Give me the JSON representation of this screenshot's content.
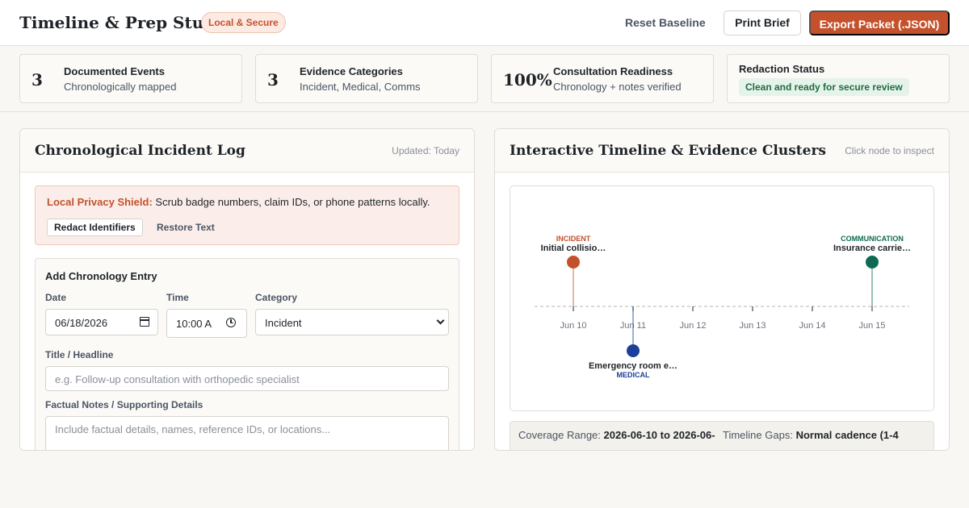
{
  "header": {
    "title": "Timeline & Prep Studio",
    "badge": "Local & Secure",
    "reset_label": "Reset Baseline",
    "print_label": "Print Brief",
    "export_label": "Export Packet (.JSON)"
  },
  "stats": [
    {
      "value": "3",
      "title": "Documented Events",
      "sub": "Chronologically mapped"
    },
    {
      "value": "3",
      "title": "Evidence Categories",
      "sub": "Incident, Medical, Comms"
    },
    {
      "value": "100%",
      "title": "Consultation Readiness",
      "sub": "Chronology + notes verified"
    }
  ],
  "redaction": {
    "title": "Redaction Status",
    "status": "Clean and ready for secure review"
  },
  "log_panel": {
    "title": "Chronological Incident Log",
    "meta": "Updated: Today",
    "shield_label": "Local Privacy Shield:",
    "shield_text": " Scrub badge numbers, claim IDs, or phone patterns locally.",
    "redact_label": "Redact Identifiers",
    "restore_label": "Restore Text",
    "form": {
      "title": "Add Chronology Entry",
      "date_label": "Date",
      "date_value": "06/18/2026",
      "time_label": "Time",
      "time_value": "10:00 A",
      "category_label": "Category",
      "category_value": "Incident",
      "headline_label": "Title / Headline",
      "headline_placeholder": "e.g. Follow-up consultation with orthopedic specialist",
      "notes_label": "Factual Notes / Supporting Details",
      "notes_placeholder": "Include factual details, names, reference IDs, or locations..."
    }
  },
  "timeline_panel": {
    "title": "Interactive Timeline & Evidence Clusters",
    "meta": "Click node to inspect",
    "coverage_label": "Coverage Range:",
    "coverage_value": "2026-06-10 to 2026-06-",
    "gaps_label": "Timeline Gaps:",
    "gaps_value": "Normal cadence (1-4"
  },
  "colors": {
    "incident": "#c4512c",
    "medical": "#1d3f9a",
    "communication": "#0e6b53"
  },
  "timeline": {
    "ticks": [
      "Jun 10",
      "Jun 11",
      "Jun 12",
      "Jun 13",
      "Jun 14",
      "Jun 15"
    ],
    "events": [
      {
        "day_index": 0,
        "category": "INCIDENT",
        "title": "Initial collisio…",
        "side": "above",
        "color_key": "incident"
      },
      {
        "day_index": 1,
        "category": "MEDICAL",
        "title": "Emergency room e…",
        "side": "below",
        "color_key": "medical"
      },
      {
        "day_index": 5,
        "category": "COMMUNICATION",
        "title": "Insurance carrie…",
        "side": "above",
        "color_key": "communication"
      }
    ]
  }
}
